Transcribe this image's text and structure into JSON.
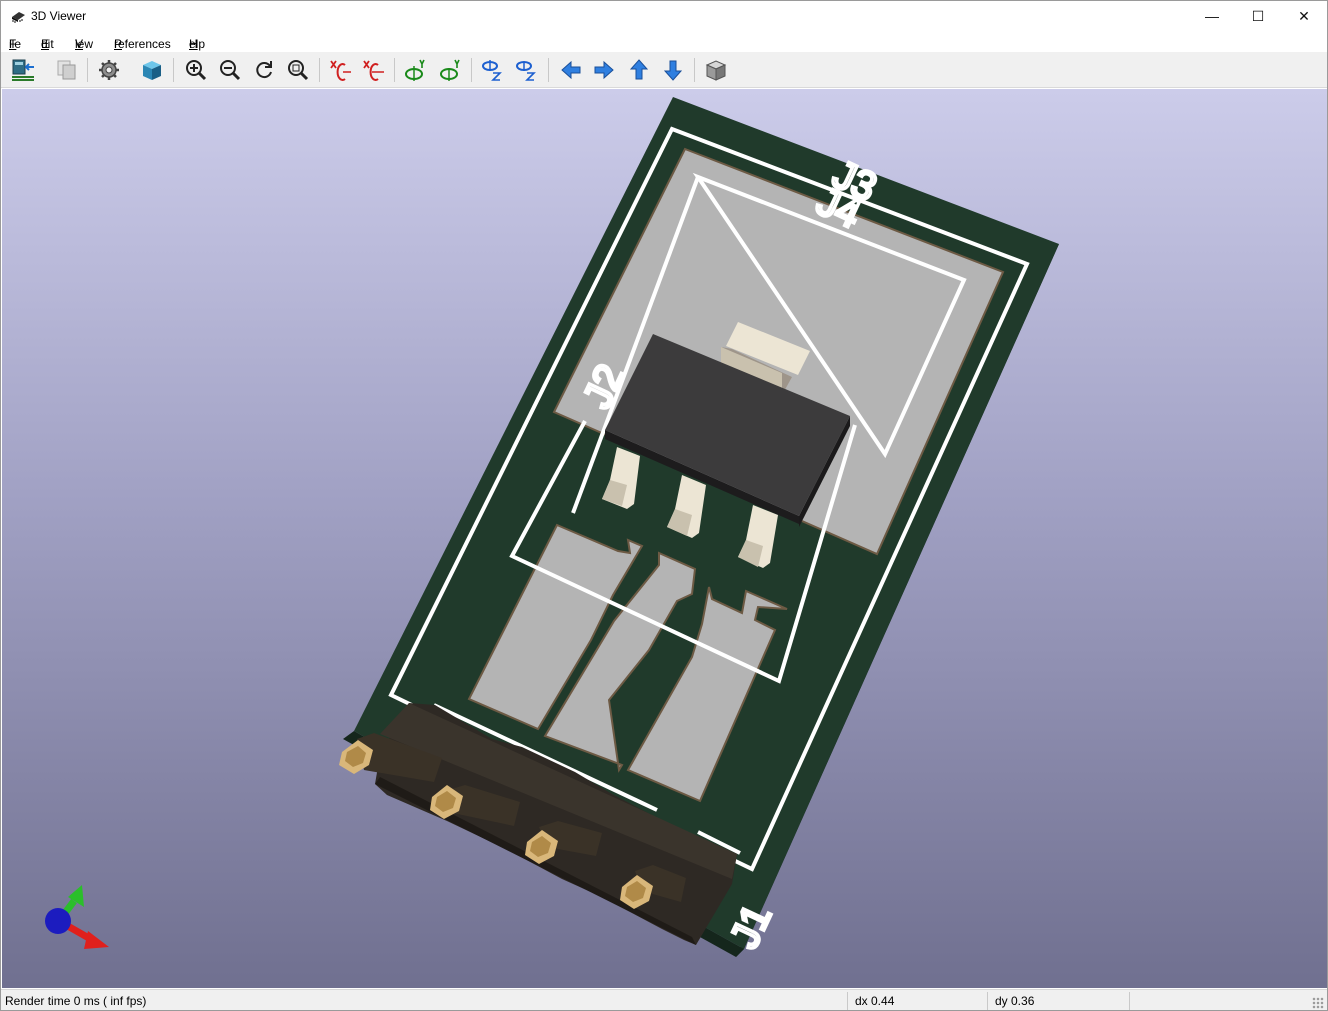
{
  "window": {
    "title": "3D Viewer",
    "controls": {
      "minimize": "—",
      "maximize": "☐",
      "close": "✕"
    }
  },
  "menu": [
    {
      "label": "File",
      "underline": "F",
      "rest": "ile"
    },
    {
      "label": "Edit",
      "underline": "E",
      "rest": "dit"
    },
    {
      "label": "View",
      "underline": "V",
      "rest": "iew"
    },
    {
      "label": "Preferences",
      "underline": "P",
      "rest": "references"
    },
    {
      "label": "Help",
      "underline": "H",
      "rest": "elp"
    }
  ],
  "toolbar": {
    "buttons": [
      "reload-board-icon",
      "copy-image-icon",
      "settings-gear-icon",
      "raytracing-cube-icon",
      "zoom-in-icon",
      "zoom-out-icon",
      "redraw-icon",
      "zoom-fit-icon",
      "rotate-x-cw-icon",
      "rotate-x-ccw-icon",
      "rotate-y-cw-icon",
      "rotate-y-ccw-icon",
      "rotate-z-cw-icon",
      "rotate-z-ccw-icon",
      "pan-left-icon",
      "pan-right-icon",
      "pan-up-icon",
      "pan-down-icon",
      "orthographic-cube-icon"
    ]
  },
  "scene": {
    "labels": {
      "j1": "J1",
      "j2": "J2",
      "j3": "J3",
      "j4": "J4"
    },
    "colors": {
      "board": "#203a2b",
      "silkscreen": "#ffffff",
      "copper_pad": "#b4b4b4",
      "ic_body": "#3c3b3c",
      "connector_body": "#2e2924",
      "pin": "#d9b77a",
      "axis_x": "#e0201c",
      "axis_y": "#2bbf2b",
      "axis_z": "#1c1cbf"
    }
  },
  "status": {
    "render_time": "Render time 0 ms ( inf fps)",
    "dx": "dx 0.44",
    "dy": "dy 0.36"
  }
}
